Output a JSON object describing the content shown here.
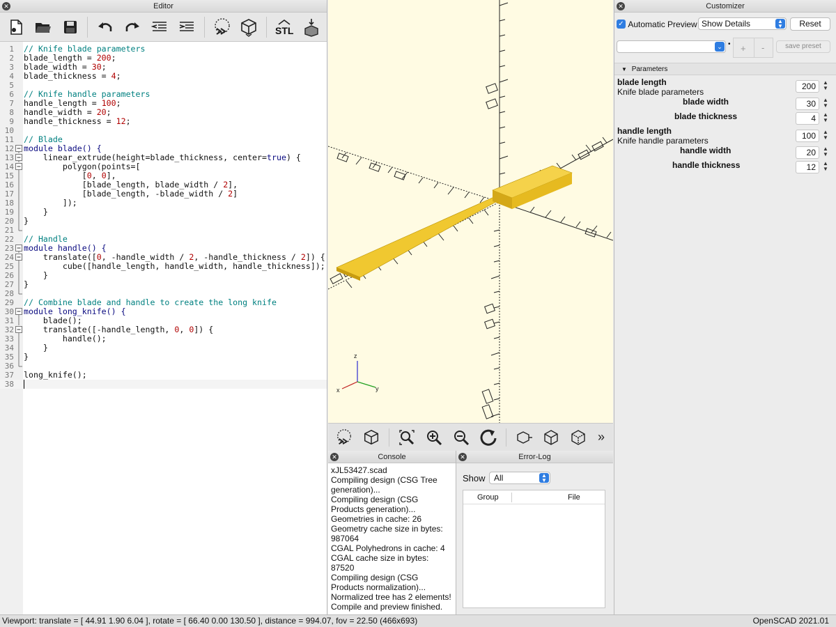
{
  "editor": {
    "title": "Editor",
    "toolbar": [
      "new-file-icon",
      "open-file-icon",
      "save-icon",
      "undo-icon",
      "redo-icon",
      "unindent-icon",
      "indent-icon",
      "preview-icon",
      "render-icon",
      "export-stl-icon",
      "send-to-print-icon"
    ],
    "stl_label": "STL",
    "lines": [
      {
        "n": "1",
        "t": "// Knife blade parameters"
      },
      {
        "n": "2",
        "t": "blade_length = 200;"
      },
      {
        "n": "3",
        "t": "blade_width = 30;"
      },
      {
        "n": "4",
        "t": "blade_thickness = 4;"
      },
      {
        "n": "5",
        "t": ""
      },
      {
        "n": "6",
        "t": "// Knife handle parameters"
      },
      {
        "n": "7",
        "t": "handle_length = 100;"
      },
      {
        "n": "8",
        "t": "handle_width = 20;"
      },
      {
        "n": "9",
        "t": "handle_thickness = 12;"
      },
      {
        "n": "10",
        "t": ""
      },
      {
        "n": "11",
        "t": "// Blade"
      },
      {
        "n": "12",
        "t": "module blade() {"
      },
      {
        "n": "13",
        "t": "    linear_extrude(height=blade_thickness, center=true) {"
      },
      {
        "n": "14",
        "t": "        polygon(points=["
      },
      {
        "n": "15",
        "t": "            [0, 0],"
      },
      {
        "n": "16",
        "t": "            [blade_length, blade_width / 2],"
      },
      {
        "n": "17",
        "t": "            [blade_length, -blade_width / 2]"
      },
      {
        "n": "18",
        "t": "        ]);"
      },
      {
        "n": "19",
        "t": "    }"
      },
      {
        "n": "20",
        "t": "}"
      },
      {
        "n": "21",
        "t": ""
      },
      {
        "n": "22",
        "t": "// Handle"
      },
      {
        "n": "23",
        "t": "module handle() {"
      },
      {
        "n": "24",
        "t": "    translate([0, -handle_width / 2, -handle_thickness / 2]) {"
      },
      {
        "n": "25",
        "t": "        cube([handle_length, handle_width, handle_thickness]);"
      },
      {
        "n": "26",
        "t": "    }"
      },
      {
        "n": "27",
        "t": "}"
      },
      {
        "n": "28",
        "t": ""
      },
      {
        "n": "29",
        "t": "// Combine blade and handle to create the long knife"
      },
      {
        "n": "30",
        "t": "module long_knife() {"
      },
      {
        "n": "31",
        "t": "    blade();"
      },
      {
        "n": "32",
        "t": "    translate([-handle_length, 0, 0]) {"
      },
      {
        "n": "33",
        "t": "        handle();"
      },
      {
        "n": "34",
        "t": "    }"
      },
      {
        "n": "35",
        "t": "}"
      },
      {
        "n": "36",
        "t": ""
      },
      {
        "n": "37",
        "t": "long_knife();"
      },
      {
        "n": "38",
        "t": ""
      }
    ]
  },
  "viewport": {
    "axis_z": "z",
    "axis_y": "y",
    "axis_x": "x",
    "toolbar": [
      "preview-icon",
      "render-icon",
      "view-all-icon",
      "zoom-in-icon",
      "zoom-out-icon",
      "reset-view-icon",
      "view-right-icon",
      "view-top-icon",
      "view-bottom-icon",
      "more-icon"
    ],
    "more": "»"
  },
  "console": {
    "title": "Console",
    "lines": [
      "xJL53427.scad",
      "Compiling design (CSG Tree generation)...",
      "Compiling design (CSG Products generation)...",
      "Geometries in cache: 26",
      "Geometry cache size in bytes: 987064",
      "CGAL Polyhedrons in cache: 4",
      "CGAL cache size in bytes: 87520",
      "Compiling design (CSG Products normalization)...",
      "Normalized tree has 2 elements!",
      "Compile and preview finished."
    ]
  },
  "errorlog": {
    "title": "Error-Log",
    "show_label": "Show",
    "show_value": "All",
    "col_group": "Group",
    "col_file": "File"
  },
  "customizer": {
    "title": "Customizer",
    "auto_preview": "Automatic Preview",
    "auto_preview_checked": true,
    "details_value": "Show Details",
    "reset": "Reset",
    "preset_value": "",
    "dot": "•",
    "plus": "+",
    "minus": "-",
    "save_preset": "save preset",
    "section": "Parameters",
    "params": {
      "blade_length_label": "blade length",
      "blade_length_desc": "Knife blade parameters",
      "blade_length_val": "200",
      "blade_width_label": "blade width",
      "blade_width_val": "30",
      "blade_thickness_label": "blade thickness",
      "blade_thickness_val": "4",
      "handle_length_label": "handle length",
      "handle_length_desc": "Knife handle parameters",
      "handle_length_val": "100",
      "handle_width_label": "handle width",
      "handle_width_val": "20",
      "handle_thickness_label": "handle thickness",
      "handle_thickness_val": "12"
    }
  },
  "status": {
    "viewport": "Viewport: translate = [ 44.91 1.90 6.04 ], rotate = [ 66.40 0.00 130.50 ], distance = 994.07, fov = 22.50 (466x693)",
    "version": "OpenSCAD 2021.01"
  },
  "colors": {
    "model": "#f3cf3a",
    "viewport_bg": "#fffbe3",
    "comment": "#008080",
    "number": "#b00000"
  }
}
